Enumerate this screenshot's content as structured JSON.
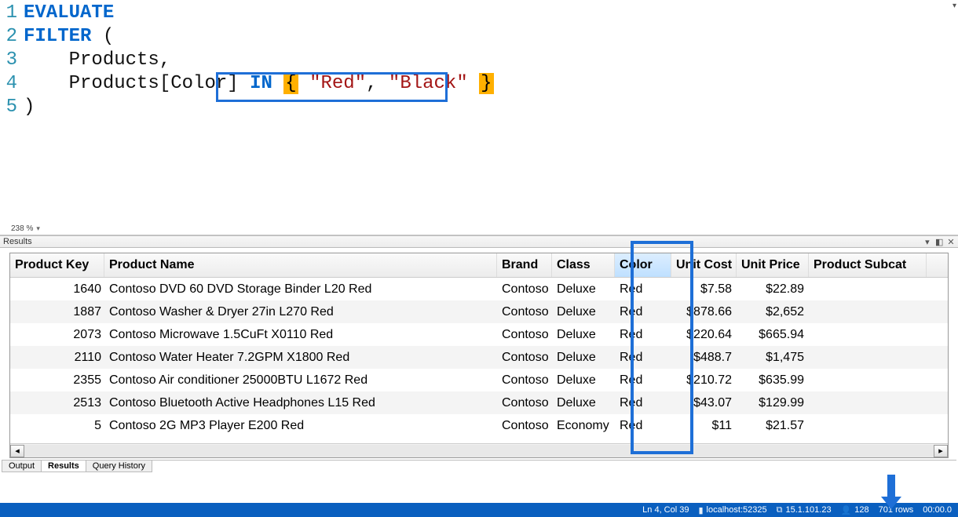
{
  "editor": {
    "zoom": "238 %",
    "cursor": "Ln 4, Col 39",
    "lines": [
      {
        "n": "1",
        "tokens": [
          {
            "cls": "kw",
            "t": "EVALUATE"
          }
        ]
      },
      {
        "n": "2",
        "tokens": [
          {
            "cls": "kw",
            "t": "FILTER "
          },
          {
            "cls": "punct",
            "t": "("
          }
        ]
      },
      {
        "n": "3",
        "tokens": [
          {
            "cls": "ident",
            "t": "    Products"
          },
          {
            "cls": "punct",
            "t": ","
          }
        ]
      },
      {
        "n": "4",
        "tokens": [
          {
            "cls": "ident",
            "t": "    Products"
          },
          {
            "cls": "box-left",
            "t": "["
          },
          {
            "cls": "ident",
            "t": "Color"
          },
          {
            "cls": "box-right",
            "t": "]"
          },
          {
            "cls": "punct",
            "t": " "
          },
          {
            "cls": "kw",
            "t": "IN "
          },
          {
            "cls": "hlbr",
            "t": "{"
          },
          {
            "cls": "punct",
            "t": " "
          },
          {
            "cls": "str",
            "t": "\"Red\""
          },
          {
            "cls": "punct",
            "t": ", "
          },
          {
            "cls": "str",
            "t": "\"Black\""
          },
          {
            "cls": "punct",
            "t": " "
          },
          {
            "cls": "hlbr",
            "t": "}"
          }
        ]
      },
      {
        "n": "5",
        "tokens": [
          {
            "cls": "punct",
            "t": ")"
          }
        ]
      }
    ]
  },
  "results": {
    "panel_label": "Results",
    "columns": [
      "Product Key",
      "Product Name",
      "Brand",
      "Class",
      "Color",
      "Unit Cost",
      "Unit Price",
      "Product Subcat"
    ],
    "rows": [
      {
        "key": "1640",
        "name": "Contoso DVD 60 DVD Storage Binder L20 Red",
        "brand": "Contoso",
        "cls": "Deluxe",
        "color": "Red",
        "uc": "$7.58",
        "up": "$22.89"
      },
      {
        "key": "1887",
        "name": "Contoso Washer & Dryer 27in L270 Red",
        "brand": "Contoso",
        "cls": "Deluxe",
        "color": "Red",
        "uc": "$878.66",
        "up": "$2,652"
      },
      {
        "key": "2073",
        "name": "Contoso Microwave 1.5CuFt X0110 Red",
        "brand": "Contoso",
        "cls": "Deluxe",
        "color": "Red",
        "uc": "$220.64",
        "up": "$665.94"
      },
      {
        "key": "2110",
        "name": "Contoso Water Heater 7.2GPM X1800 Red",
        "brand": "Contoso",
        "cls": "Deluxe",
        "color": "Red",
        "uc": "$488.7",
        "up": "$1,475"
      },
      {
        "key": "2355",
        "name": "Contoso Air conditioner 25000BTU L1672 Red",
        "brand": "Contoso",
        "cls": "Deluxe",
        "color": "Red",
        "uc": "$210.72",
        "up": "$635.99"
      },
      {
        "key": "2513",
        "name": "Contoso Bluetooth Active Headphones L15 Red",
        "brand": "Contoso",
        "cls": "Deluxe",
        "color": "Red",
        "uc": "$43.07",
        "up": "$129.99"
      },
      {
        "key": "5",
        "name": "Contoso 2G MP3 Player E200 Red",
        "brand": "Contoso",
        "cls": "Economy",
        "color": "Red",
        "uc": "$11",
        "up": "$21.57"
      }
    ]
  },
  "tabs": {
    "items": [
      "Output",
      "Results",
      "Query History"
    ],
    "active": 1
  },
  "status": {
    "cursor": "Ln 4, Col 39",
    "server": "localhost:52325",
    "version": "15.1.101.23",
    "users": "128",
    "rows": "701 rows",
    "time": "00:00.0"
  }
}
